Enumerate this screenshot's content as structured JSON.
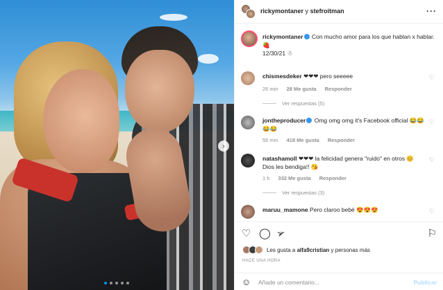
{
  "post": {
    "header": {
      "user1": "rickymontaner",
      "separator": "y",
      "user2": "stefroitman",
      "more_icon": "more-icon"
    },
    "caption": {
      "username": "rickymontaner",
      "text": "Con mucho amor para los que hablan x hablar. 🍓",
      "date": "12/30/21 ☃"
    },
    "comments": [
      {
        "username": "chismesdeker",
        "text": "❤❤❤ pero seeeee",
        "time": "26 min",
        "likes": "28 Me gusta",
        "reply": "Responder",
        "replies": "Ver respuestas (5)",
        "avatar_color": "#d2a98a"
      },
      {
        "username": "jontheproducer",
        "text": "Omg omg omg it's Facebook official 😂😂😂😂",
        "time": "56 min",
        "likes": "418 Me gusta",
        "reply": "Responder",
        "replies": "",
        "avatar_color": "#8d8d8d"
      },
      {
        "username": "natashamoll",
        "text": "❤❤❤ la felicidad genera \"ruido\" en otros 😊 Dios les bendiga!! 😘",
        "time": "1 h",
        "likes": "332 Me gusta",
        "reply": "Responder",
        "replies": "Ver respuestas (3)",
        "avatar_color": "#2b2b2b"
      },
      {
        "username": "maruu_mamone",
        "text": "Pero claroo bebé 😍😍😍",
        "time": "",
        "likes": "",
        "reply": "",
        "replies": "",
        "avatar_color": "#a87d66"
      }
    ],
    "likes_text_prefix": "Les gusta a",
    "likes_user": "alfa9cristian",
    "likes_text_suffix": "y personas más",
    "time_ago": "HACE UNA HORA",
    "add_comment_placeholder": "Añade un comentario...",
    "publish_label": "Publicar"
  },
  "carousel": {
    "dots": 5,
    "active": 0
  }
}
